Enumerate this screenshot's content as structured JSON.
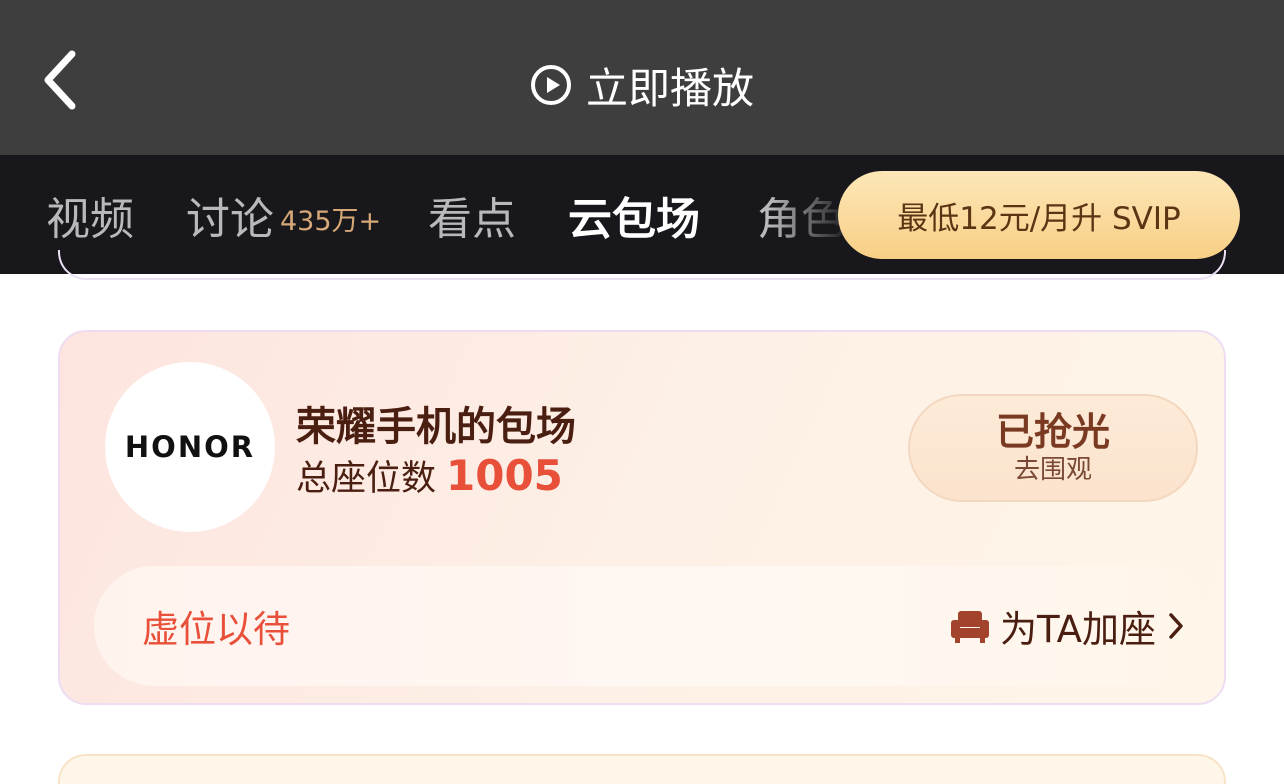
{
  "header": {
    "back_icon": "chevron-left-icon",
    "play_icon": "play-circle-icon",
    "play_label": "立即播放"
  },
  "tabs": [
    {
      "label": "视频",
      "count": ""
    },
    {
      "label": "讨论",
      "count": "435万+"
    },
    {
      "label": "看点",
      "count": ""
    },
    {
      "label": "云包场",
      "count": "",
      "active": true
    },
    {
      "label": "角色",
      "count": ""
    }
  ],
  "promo": {
    "svip_label": "最低12元/月升 SVIP"
  },
  "card": {
    "logo_text": "HONOR",
    "title": "荣耀手机的包场",
    "seat_label": "总座位数",
    "seat_count": "1005",
    "status_main": "已抢光",
    "status_sub": "去围观",
    "waiting_text": "虚位以待",
    "add_seat_label": "为TA加座",
    "seat_icon": "armchair-icon",
    "chevron_icon": "chevron-right-icon"
  },
  "colors": {
    "accent_red": "#e8503a",
    "gold": "#f8cf86",
    "dark_brown": "#4a1e10"
  }
}
